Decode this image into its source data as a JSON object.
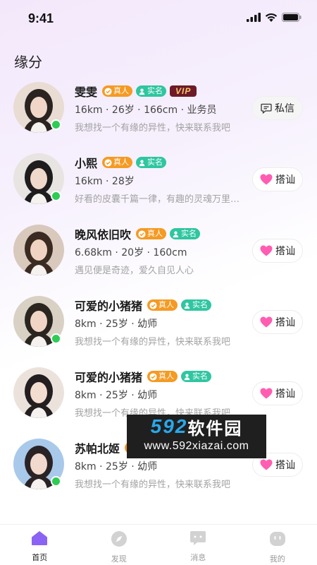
{
  "status_bar": {
    "time": "9:41"
  },
  "page_title": "缘分",
  "users": [
    {
      "name": "雯雯",
      "badges": [
        "真人",
        "实名",
        "VIP"
      ],
      "info": "16km · 26岁 · 166cm · 业务员",
      "bio": "我想找一个有缘的异性，快来联系我吧",
      "online": true,
      "action": "私信",
      "action_type": "message"
    },
    {
      "name": "小熙",
      "badges": [
        "真人",
        "实名"
      ],
      "info": "16km · 28岁",
      "bio": "好看的皮囊千篇一律，有趣的灵魂万里挑一",
      "online": true,
      "action": "搭讪",
      "action_type": "greet"
    },
    {
      "name": "晚风依旧吹",
      "badges": [
        "真人",
        "实名"
      ],
      "info": "6.68km · 20岁 · 160cm",
      "bio": "遇见便是奇迹，爱久自见人心",
      "online": false,
      "action": "搭讪",
      "action_type": "greet"
    },
    {
      "name": "可爱的小猪猪",
      "badges": [
        "真人",
        "实名"
      ],
      "info": "8km · 25岁 · 幼师",
      "bio": "我想找一个有缘的异性，快来联系我吧",
      "online": true,
      "action": "搭讪",
      "action_type": "greet"
    },
    {
      "name": "可爱的小猪猪",
      "badges": [
        "真人",
        "实名"
      ],
      "info": "8km · 25岁 · 幼师",
      "bio": "我想找一个有缘的异性，快来联系我吧",
      "online": false,
      "action": "搭讪",
      "action_type": "greet"
    },
    {
      "name": "苏帕北姬",
      "badges": [
        "真人",
        "实名"
      ],
      "info": "8km · 25岁 · 幼师",
      "bio": "我想找一个有缘的异性，快来联系我吧",
      "online": true,
      "action": "搭讪",
      "action_type": "greet"
    }
  ],
  "watermark": {
    "brand": "592软件园",
    "url": "www.592xiazai.com"
  },
  "tabs": [
    {
      "label": "首页",
      "icon": "home-icon",
      "active": true
    },
    {
      "label": "发现",
      "icon": "discover-icon",
      "active": false
    },
    {
      "label": "消息",
      "icon": "message-icon",
      "active": false
    },
    {
      "label": "我的",
      "icon": "profile-icon",
      "active": false
    }
  ],
  "colors": {
    "online": "#2ecc55",
    "real_badge": "#f59a23",
    "verified_badge": "#2fc6a0",
    "vip_badge": "#6e1a28",
    "heart": "#ff5db1",
    "tab_active": "#8a63f5"
  }
}
